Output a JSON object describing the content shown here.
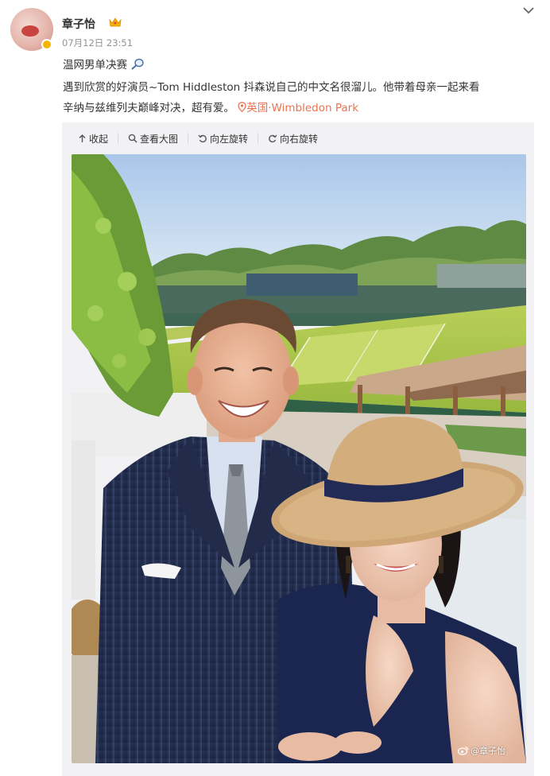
{
  "post": {
    "username": "章子怡",
    "timestamp": "07月12日 23:51",
    "line1": "温网男单决赛",
    "line2": "遇到欣赏的好演员~Tom Hiddleston 抖森说自己的中文名很溜儿。他带着母亲一起来看",
    "line3": "辛纳与兹维列夫巅峰对决，超有爱。",
    "location": "英国·Wimbledon Park"
  },
  "toolbar": {
    "collapse": "收起",
    "view_large": "查看大图",
    "rotate_left": "向左旋转",
    "rotate_right": "向右旋转"
  },
  "watermark": "@章子怡",
  "colors": {
    "location": "#eb7350",
    "media_bg": "#f2f2f5"
  }
}
